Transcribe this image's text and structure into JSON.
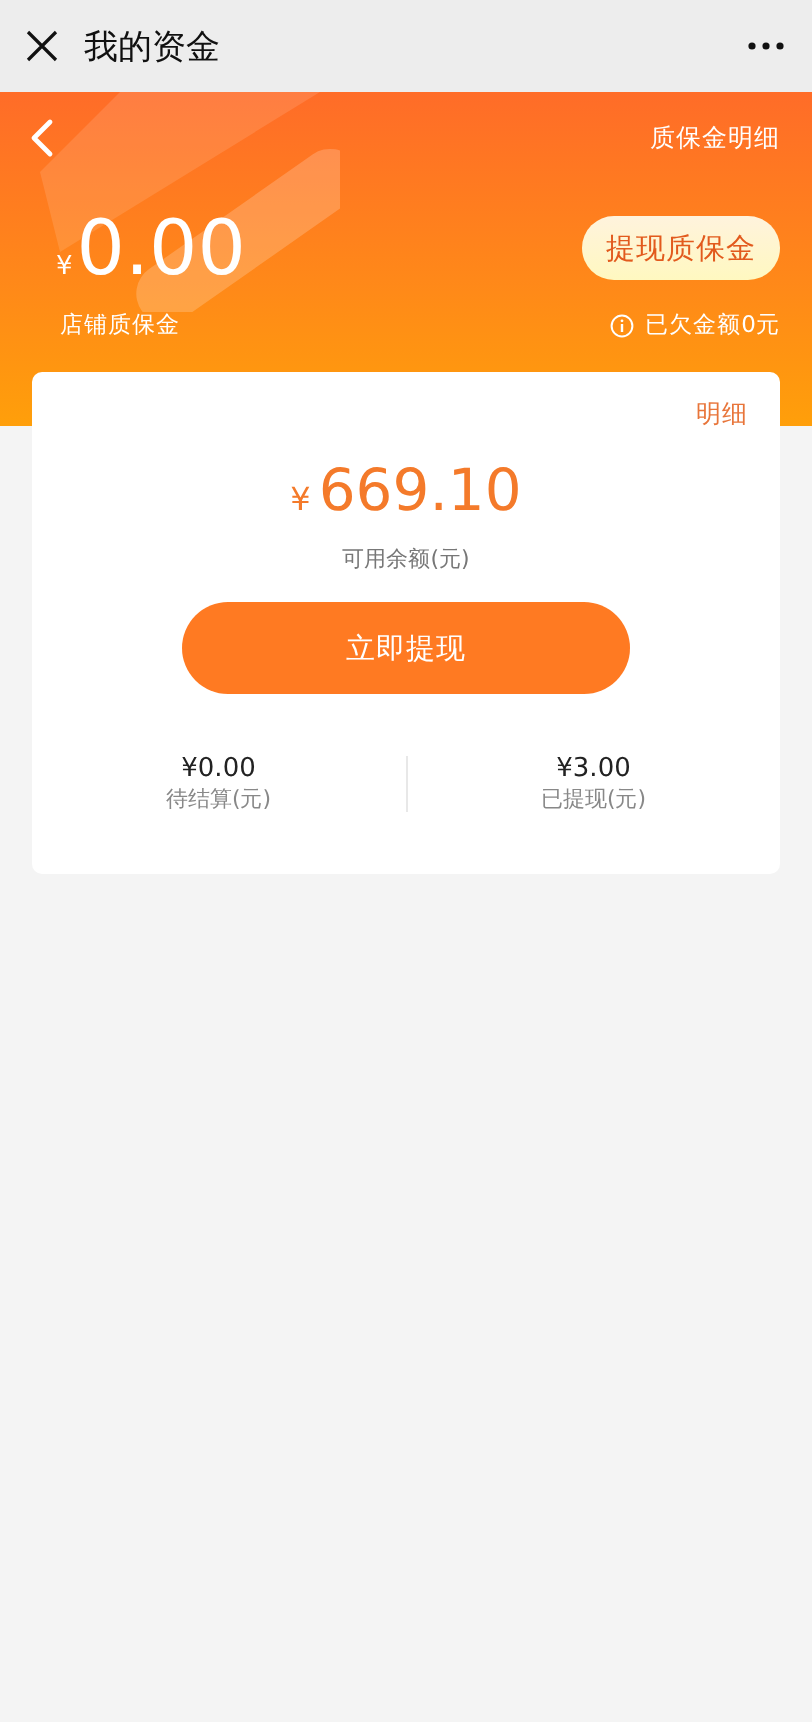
{
  "nav_bar": {
    "title": "我的资金"
  },
  "header": {
    "detail_link": "质保金明细",
    "currency": "¥",
    "amount": "0.00",
    "label": "店铺质保金",
    "withdraw_button": "提现质保金",
    "debt": "已欠金额0元"
  },
  "card": {
    "detail_link": "明细",
    "currency": "¥",
    "amount": "669.10",
    "caption": "可用余额(元)",
    "withdraw_button": "立即提现",
    "stats": [
      {
        "value": "¥0.00",
        "label": "待结算(元)"
      },
      {
        "value": "¥3.00",
        "label": "已提现(元)"
      }
    ]
  }
}
